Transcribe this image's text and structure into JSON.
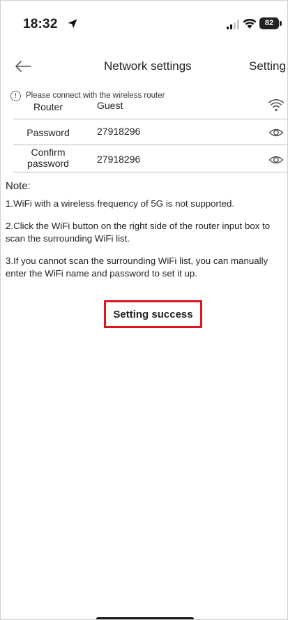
{
  "status_bar": {
    "time": "18:32",
    "battery": "82",
    "icons": [
      "location-arrow-icon",
      "signal-icon",
      "wifi-icon",
      "battery-icon"
    ]
  },
  "nav": {
    "title": "Network settings",
    "action": "Setting",
    "back_icon": "back-arrow-icon"
  },
  "info": {
    "icon": "info-icon",
    "icon_glyph": "!",
    "text": "Please connect with the wireless router"
  },
  "form": {
    "router": {
      "label": "Router",
      "value": "Guest",
      "icon": "wifi-scan-icon"
    },
    "password": {
      "label": "Password",
      "value": "27918296",
      "icon": "eye-icon"
    },
    "confirm": {
      "label_line1": "Confirm",
      "label_line2": "password",
      "value": "27918296",
      "icon": "eye-icon"
    }
  },
  "note": {
    "title": "Note:",
    "items": [
      "1.WiFi with a wireless frequency of 5G is not supported.",
      "2.Click the WiFi button on the right side of the router input box to scan the surrounding WiFi list.",
      "3.If you cannot scan the surrounding WiFi list, you can manually enter the WiFi name and password to set it up."
    ]
  },
  "toast": {
    "text": "Setting success",
    "highlight_color": "#e0141e"
  }
}
